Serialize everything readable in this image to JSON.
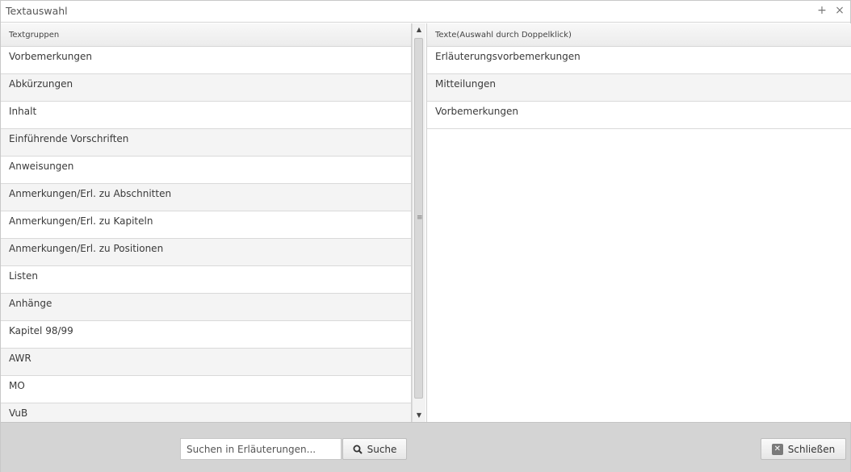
{
  "window": {
    "title": "Textauswahl",
    "maximize_icon": "+",
    "close_icon": "×"
  },
  "left_panel": {
    "header": "Textgruppen",
    "items": [
      "Vorbemerkungen",
      "Abkürzungen",
      "Inhalt",
      "Einführende Vorschriften",
      "Anweisungen",
      "Anmerkungen/Erl. zu Abschnitten",
      "Anmerkungen/Erl. zu Kapiteln",
      "Anmerkungen/Erl. zu Positionen",
      "Listen",
      "Anhänge",
      "Kapitel 98/99",
      "AWR",
      "MO",
      "VuB"
    ]
  },
  "right_panel": {
    "header": "Texte(Auswahl durch Doppelklick)",
    "items": [
      "Erläuterungsvorbemerkungen",
      "Mitteilungen",
      "Vorbemerkungen"
    ]
  },
  "footer": {
    "search_placeholder": "Suchen in Erläuterungen...",
    "search_value": "",
    "search_button": "Suche",
    "close_button": "Schließen"
  },
  "icons": {
    "search": "magnifier-icon",
    "close": "x-box-icon"
  },
  "colors": {
    "footer_bg": "#d4d4d4",
    "row_alt": "#f4f4f4",
    "border": "#d6d6d6"
  }
}
